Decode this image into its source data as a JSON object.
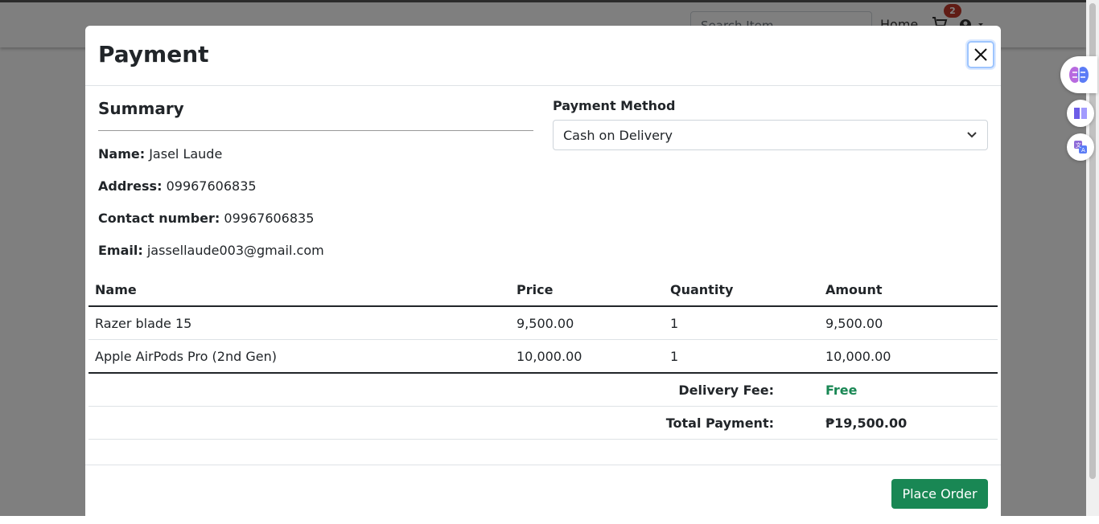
{
  "background": {
    "search_placeholder": "Search Item",
    "home_label": "Home",
    "cart_count": "2",
    "cart_icon": "shopping-cart-icon",
    "user_icon": "user-circle-icon"
  },
  "extensions": {
    "icons": [
      "brain-icon",
      "book-icon",
      "translate-icon"
    ]
  },
  "modal": {
    "title": "Payment",
    "close_icon": "close-icon",
    "summary_title": "Summary",
    "name_label": "Name:",
    "name_value": "Jasel Laude",
    "address_label": "Address:",
    "address_value": "09967606835",
    "contact_label": "Contact number:",
    "contact_value": "09967606835",
    "email_label": "Email:",
    "email_value": "jassellaude003@gmail.com",
    "payment_method_label": "Payment Method",
    "payment_method_value": "Cash on Delivery",
    "table": {
      "headers": [
        "Name",
        "Price",
        "Quantity",
        "Amount"
      ],
      "rows": [
        [
          "Razer blade 15",
          "9,500.00",
          "1",
          "9,500.00"
        ],
        [
          "Apple AirPods Pro (2nd Gen)",
          "10,000.00",
          "1",
          "10,000.00"
        ]
      ],
      "delivery_fee_label": "Delivery Fee:",
      "delivery_fee_value": "Free",
      "total_label": "Total Payment:",
      "total_value": "₱19,500.00"
    },
    "place_order_label": "Place Order"
  },
  "colors": {
    "success": "#198754",
    "badge": "#c0392b"
  }
}
